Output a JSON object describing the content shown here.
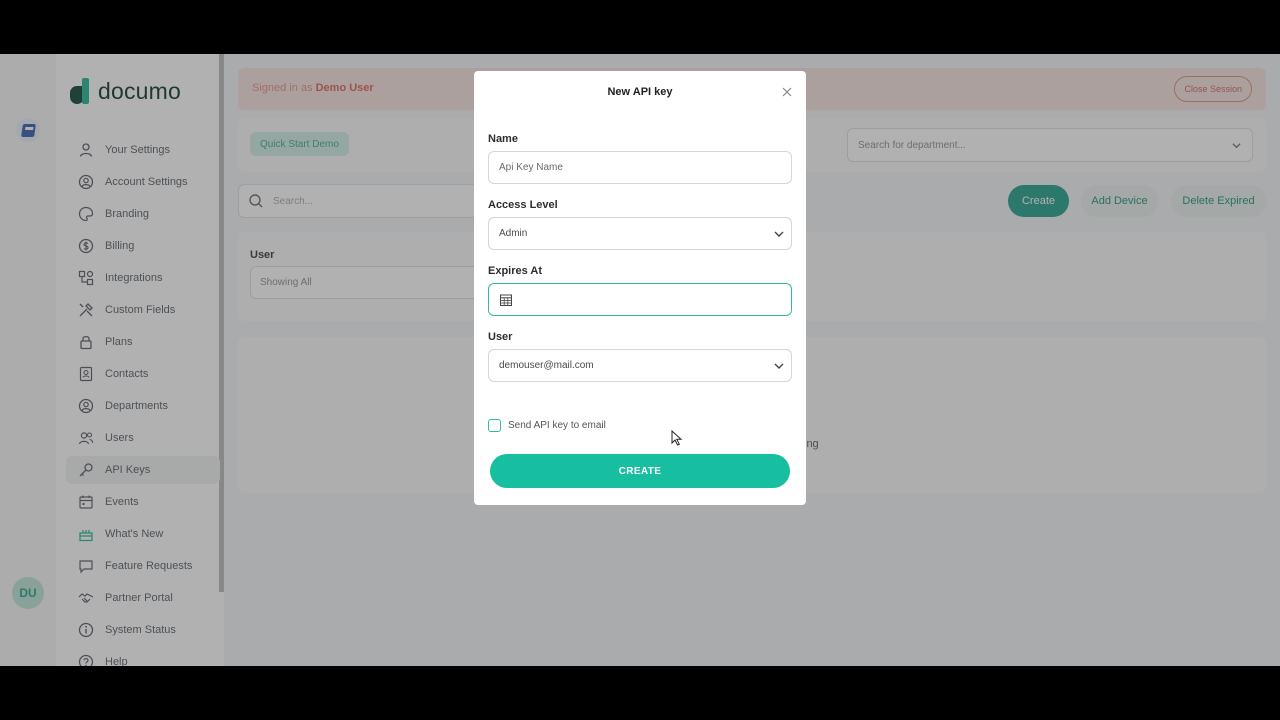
{
  "app": {
    "brand": "documo",
    "rail_avatar_initials": "DU"
  },
  "sidebar": {
    "items": [
      {
        "label": "Your Settings",
        "icon": "user-icon"
      },
      {
        "label": "Account Settings",
        "icon": "user-circle-icon"
      },
      {
        "label": "Branding",
        "icon": "palette-icon"
      },
      {
        "label": "Billing",
        "icon": "dollar-icon"
      },
      {
        "label": "Integrations",
        "icon": "integrations-icon"
      },
      {
        "label": "Custom Fields",
        "icon": "tools-icon"
      },
      {
        "label": "Plans",
        "icon": "lock-icon"
      },
      {
        "label": "Contacts",
        "icon": "contact-book-icon"
      },
      {
        "label": "Departments",
        "icon": "user-circle-icon"
      },
      {
        "label": "Users",
        "icon": "users-icon"
      },
      {
        "label": "API Keys",
        "icon": "key-icon",
        "active": true
      },
      {
        "label": "Events",
        "icon": "calendar-icon"
      },
      {
        "label": "What's New",
        "icon": "cake-icon"
      },
      {
        "label": "Feature Requests",
        "icon": "chat-icon"
      },
      {
        "label": "Partner Portal",
        "icon": "handshake-icon"
      },
      {
        "label": "System Status",
        "icon": "info-icon"
      },
      {
        "label": "Help",
        "icon": "help-icon"
      }
    ]
  },
  "banner": {
    "signed_prefix": "Signed in as",
    "signed_user": "Demo User",
    "close_session": "Close Session"
  },
  "filters": {
    "quick_start": "Quick Start Demo",
    "department_placeholder": "Search for department..."
  },
  "toolbar": {
    "search_placeholder": "Search...",
    "create": "Create",
    "add_device": "Add Device",
    "delete_expired": "Delete Expired"
  },
  "user_filter": {
    "label": "User",
    "value": "Showing All"
  },
  "table": {
    "empty_text_visible": "ing"
  },
  "modal": {
    "title": "New API key",
    "name_label": "Name",
    "name_placeholder": "Api Key Name",
    "access_label": "Access Level",
    "access_value": "Admin",
    "expires_label": "Expires At",
    "user_label": "User",
    "user_value": "demouser@mail.com",
    "send_email_label": "Send API key to email",
    "submit": "CREATE"
  },
  "colors": {
    "brand_teal": "#17bfa0",
    "focus": "#33b99f",
    "banner_bg": "#f7e2de"
  }
}
